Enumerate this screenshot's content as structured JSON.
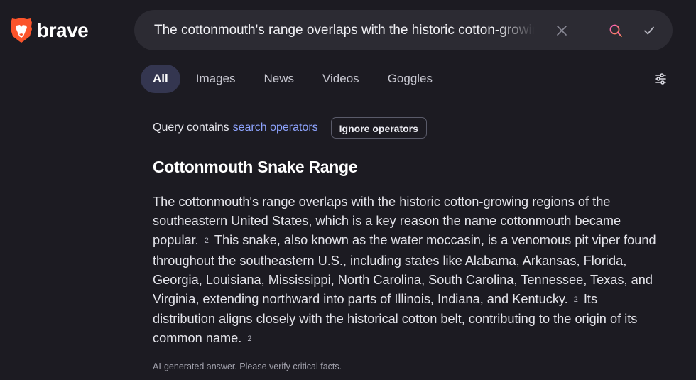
{
  "brand": {
    "name": "brave",
    "logo_icon": "brave-lion-icon",
    "accent": "#fb542b"
  },
  "search": {
    "query": "The cottonmouth's range overlaps with the historic cotton-growing regions",
    "clear_icon": "close-icon",
    "search_icon": "search-icon",
    "submit_icon": "checkmark-icon"
  },
  "tabs": [
    {
      "label": "All",
      "active": true
    },
    {
      "label": "Images",
      "active": false
    },
    {
      "label": "News",
      "active": false
    },
    {
      "label": "Videos",
      "active": false
    },
    {
      "label": "Goggles",
      "active": false
    }
  ],
  "filter_icon": "sliders-icon",
  "operators": {
    "prefix": "Query contains",
    "link": "search operators",
    "button": "Ignore operators"
  },
  "answer": {
    "title": "Cottonmouth Snake Range",
    "segments": [
      {
        "text": "The cottonmouth's range overlaps with the historic cotton-growing regions of the southeastern United States, which is a key reason the name cottonmouth became popular.",
        "cite": "2"
      },
      {
        "text": "This snake, also known as the water moccasin, is a venomous pit viper found throughout the southeastern U.S., including states like Alabama, Arkansas, Florida, Georgia, Louisiana, Mississippi, North Carolina, South Carolina, Tennessee, Texas, and Virginia, extending northward into parts of Illinois, Indiana, and Kentucky.",
        "cite": "2"
      },
      {
        "text": "Its distribution aligns closely with the historical cotton belt, contributing to the origin of its common name.",
        "cite": "2"
      }
    ],
    "disclaimer": "AI-generated answer. Please verify critical facts."
  },
  "colors": {
    "background": "#1c1b22",
    "searchbar": "#2c2b33",
    "active_tab": "#343650",
    "link": "#8ea4ff"
  }
}
